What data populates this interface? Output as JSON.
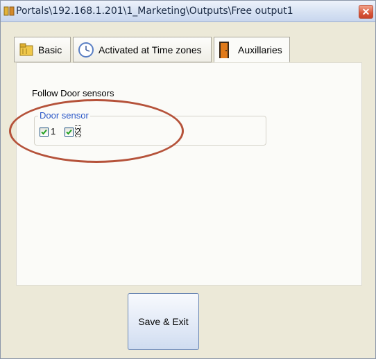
{
  "window": {
    "title": "Portals\\192.168.1.201\\1_Marketing\\Outputs\\Free output1",
    "close_glyph": "✕"
  },
  "tabs": [
    {
      "label": "Basic",
      "icon": "folder-icon",
      "active": false
    },
    {
      "label": "Activated at Time zones",
      "icon": "clock-icon",
      "active": false
    },
    {
      "label": "Auxillaries",
      "icon": "door-icon",
      "active": true
    }
  ],
  "panel": {
    "section_title": "Follow Door sensors",
    "group_caption": "Door sensor",
    "sensors": [
      {
        "label": "1",
        "checked": true
      },
      {
        "label": "2",
        "checked": true
      }
    ]
  },
  "footer": {
    "save_label": "Save & Exit"
  },
  "colors": {
    "highlight_ring": "#b5523a",
    "group_caption": "#2b58c8",
    "checkmark": "#21a121"
  }
}
